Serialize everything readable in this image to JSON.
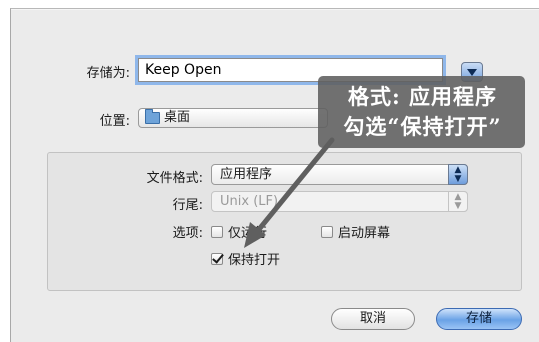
{
  "dialog": {
    "save_as_label": "存储为:",
    "save_as_value": "Keep Open",
    "location_label": "位置:",
    "location_value": "桌面",
    "location_icon": "folder-icon",
    "expand_icon": "triangle-down-icon"
  },
  "options": {
    "format_label": "文件格式:",
    "format_value": "应用程序",
    "line_ending_label": "行尾:",
    "line_ending_value": "Unix (LF)",
    "options_label": "选项:",
    "checkboxes": [
      {
        "label": "仅运行",
        "checked": false
      },
      {
        "label": "启动屏幕",
        "checked": false
      },
      {
        "label": "保持打开",
        "checked": true
      }
    ]
  },
  "buttons": {
    "cancel": "取消",
    "save": "存储"
  },
  "annotation": {
    "line1": "格式: 应用程序",
    "line2": "勾选“保持打开”",
    "color": "#5f5f5f"
  }
}
